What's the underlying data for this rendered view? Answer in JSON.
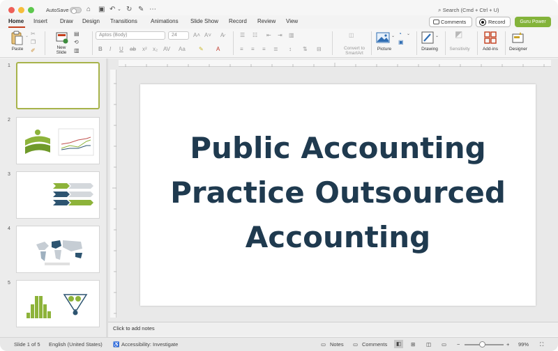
{
  "titlebar": {
    "autosave_label": "AutoSave",
    "search_placeholder": "Search (Cmd + Ctrl + U)"
  },
  "tabs": [
    {
      "label": "Home",
      "active": true
    },
    {
      "label": "Insert"
    },
    {
      "label": "Draw"
    },
    {
      "label": "Design"
    },
    {
      "label": "Transitions"
    },
    {
      "label": "Animations"
    },
    {
      "label": "Slide Show"
    },
    {
      "label": "Record"
    },
    {
      "label": "Review"
    },
    {
      "label": "View"
    }
  ],
  "actions": {
    "comments_label": "Comments",
    "record_label": "Record",
    "guru_label": "Guru Power"
  },
  "ribbon": {
    "paste_label": "Paste",
    "new_slide_label_1": "New",
    "new_slide_label_2": "Slide",
    "font_name": "Aptos (Body)",
    "font_size": "24",
    "convert_label_1": "Convert to",
    "convert_label_2": "SmartArt",
    "picture_label": "Picture",
    "drawing_label": "Drawing",
    "sensitivity_label": "Sensitivity",
    "addins_label": "Add-ins",
    "designer_label": "Designer"
  },
  "slides": [
    {
      "number": "1"
    },
    {
      "number": "2"
    },
    {
      "number": "3"
    },
    {
      "number": "4"
    },
    {
      "number": "5"
    }
  ],
  "slide": {
    "title_line1": "Public Accounting",
    "title_line2": "Practice Outsourced",
    "title_line3": "Accounting"
  },
  "notes_placeholder": "Click to add notes",
  "status": {
    "slide_count": "Slide 1 of 5",
    "language": "English (United States)",
    "accessibility": "Accessibility: Investigate",
    "notes_label": "Notes",
    "comments_label": "Comments",
    "zoom": "99%"
  },
  "colors": {
    "accent_tab": "#c43e1c",
    "guru_green": "#83b33a",
    "title_navy": "#1f3a4f",
    "thumb_green": "#8db33a",
    "thumb_navy": "#2d5470"
  }
}
